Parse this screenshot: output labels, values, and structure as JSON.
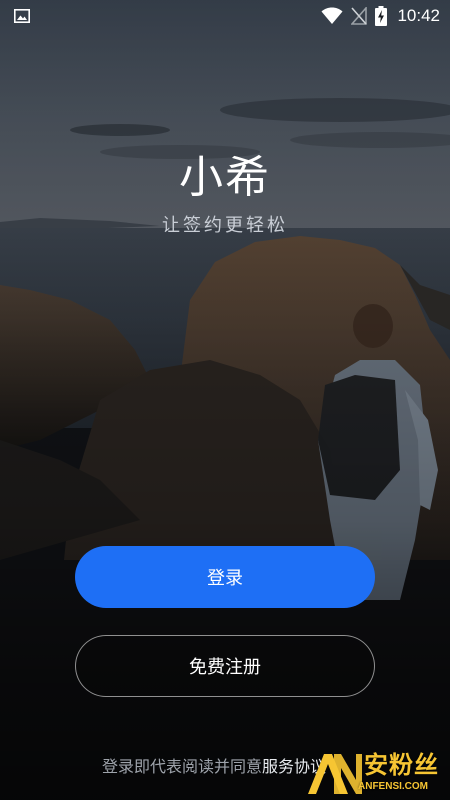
{
  "status_bar": {
    "time": "10:42",
    "icons": [
      "gallery-icon",
      "wifi-icon",
      "no-signal-icon",
      "battery-charging-icon"
    ]
  },
  "brand": {
    "title": "小希",
    "slogan": "让签约更轻松"
  },
  "buttons": {
    "login_label": "登录",
    "register_label": "免费注册"
  },
  "agreement": {
    "prefix": "登录即代表阅读并同意",
    "link": "服务协议"
  },
  "watermark": {
    "cn": "安粉丝",
    "en": "ANFENSI.COM"
  },
  "colors": {
    "primary": "#1e6ff5",
    "background": "#111317",
    "watermark": "#f6c533"
  }
}
